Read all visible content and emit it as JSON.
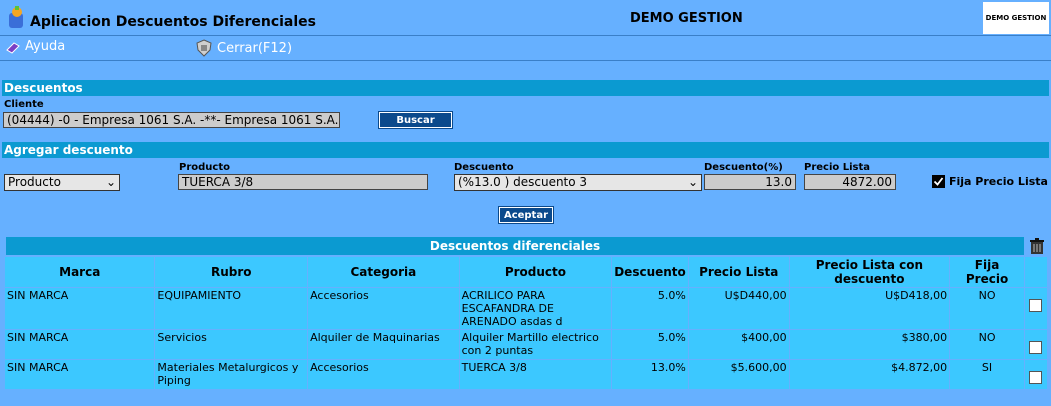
{
  "header": {
    "title": "Aplicacion Descuentos Diferenciales",
    "company": "DEMO GESTION",
    "brand_logo_text": "DEMO GESTION"
  },
  "menu": {
    "help": "Ayuda",
    "close": "Cerrar(F12)"
  },
  "descuentos": {
    "section_title": "Descuentos",
    "cliente_label": "Cliente",
    "cliente_value": "(04444) -0 - Empresa 1061 S.A. -**- Empresa 1061 S.A.",
    "buscar_label": "Buscar"
  },
  "agregar": {
    "section_title": "Agregar descuento",
    "tipo_value": "Producto",
    "producto_label": "Producto",
    "producto_value": "TUERCA 3/8",
    "descuento_label": "Descuento",
    "descuento_value": "(%13.0 ) descuento 3",
    "porcentaje_label": "Descuento(%)",
    "porcentaje_value": "13.0",
    "precio_label": "Precio Lista",
    "precio_value": "4872.00",
    "fija_label": "Fija Precio Lista",
    "fija_checked": true,
    "aceptar_label": "Aceptar"
  },
  "grid": {
    "title": "Descuentos diferenciales",
    "columns": [
      "Marca",
      "Rubro",
      "Categoria",
      "Producto",
      "Descuento",
      "Precio Lista",
      "Precio Lista con descuento",
      "Fija Precio"
    ],
    "rows": [
      {
        "marca": "SIN MARCA",
        "rubro": "EQUIPAMIENTO",
        "categoria": "Accesorios",
        "producto": "ACRILICO PARA ESCAFANDRA DE ARENADO asdas d",
        "descuento": "5.0%",
        "precio": "U$D440,00",
        "precio_desc": "U$D418,00",
        "fija": "NO"
      },
      {
        "marca": "SIN MARCA",
        "rubro": "Servicios",
        "categoria": "Alquiler de Maquinarias",
        "producto": "Alquiler Martillo electrico con 2 puntas",
        "descuento": "5.0%",
        "precio": "$400,00",
        "precio_desc": "$380,00",
        "fija": "NO"
      },
      {
        "marca": "SIN MARCA",
        "rubro": "Materiales Metalurgicos y Piping",
        "categoria": "Accesorios",
        "producto": "TUERCA 3/8",
        "descuento": "13.0%",
        "precio": "$5.600,00",
        "precio_desc": "$4.872,00",
        "fija": "SI"
      }
    ]
  },
  "icons": {
    "app": "app-logo-icon",
    "help": "help-book-icon",
    "close": "shield-exit-icon",
    "delete": "trash-can-icon"
  }
}
